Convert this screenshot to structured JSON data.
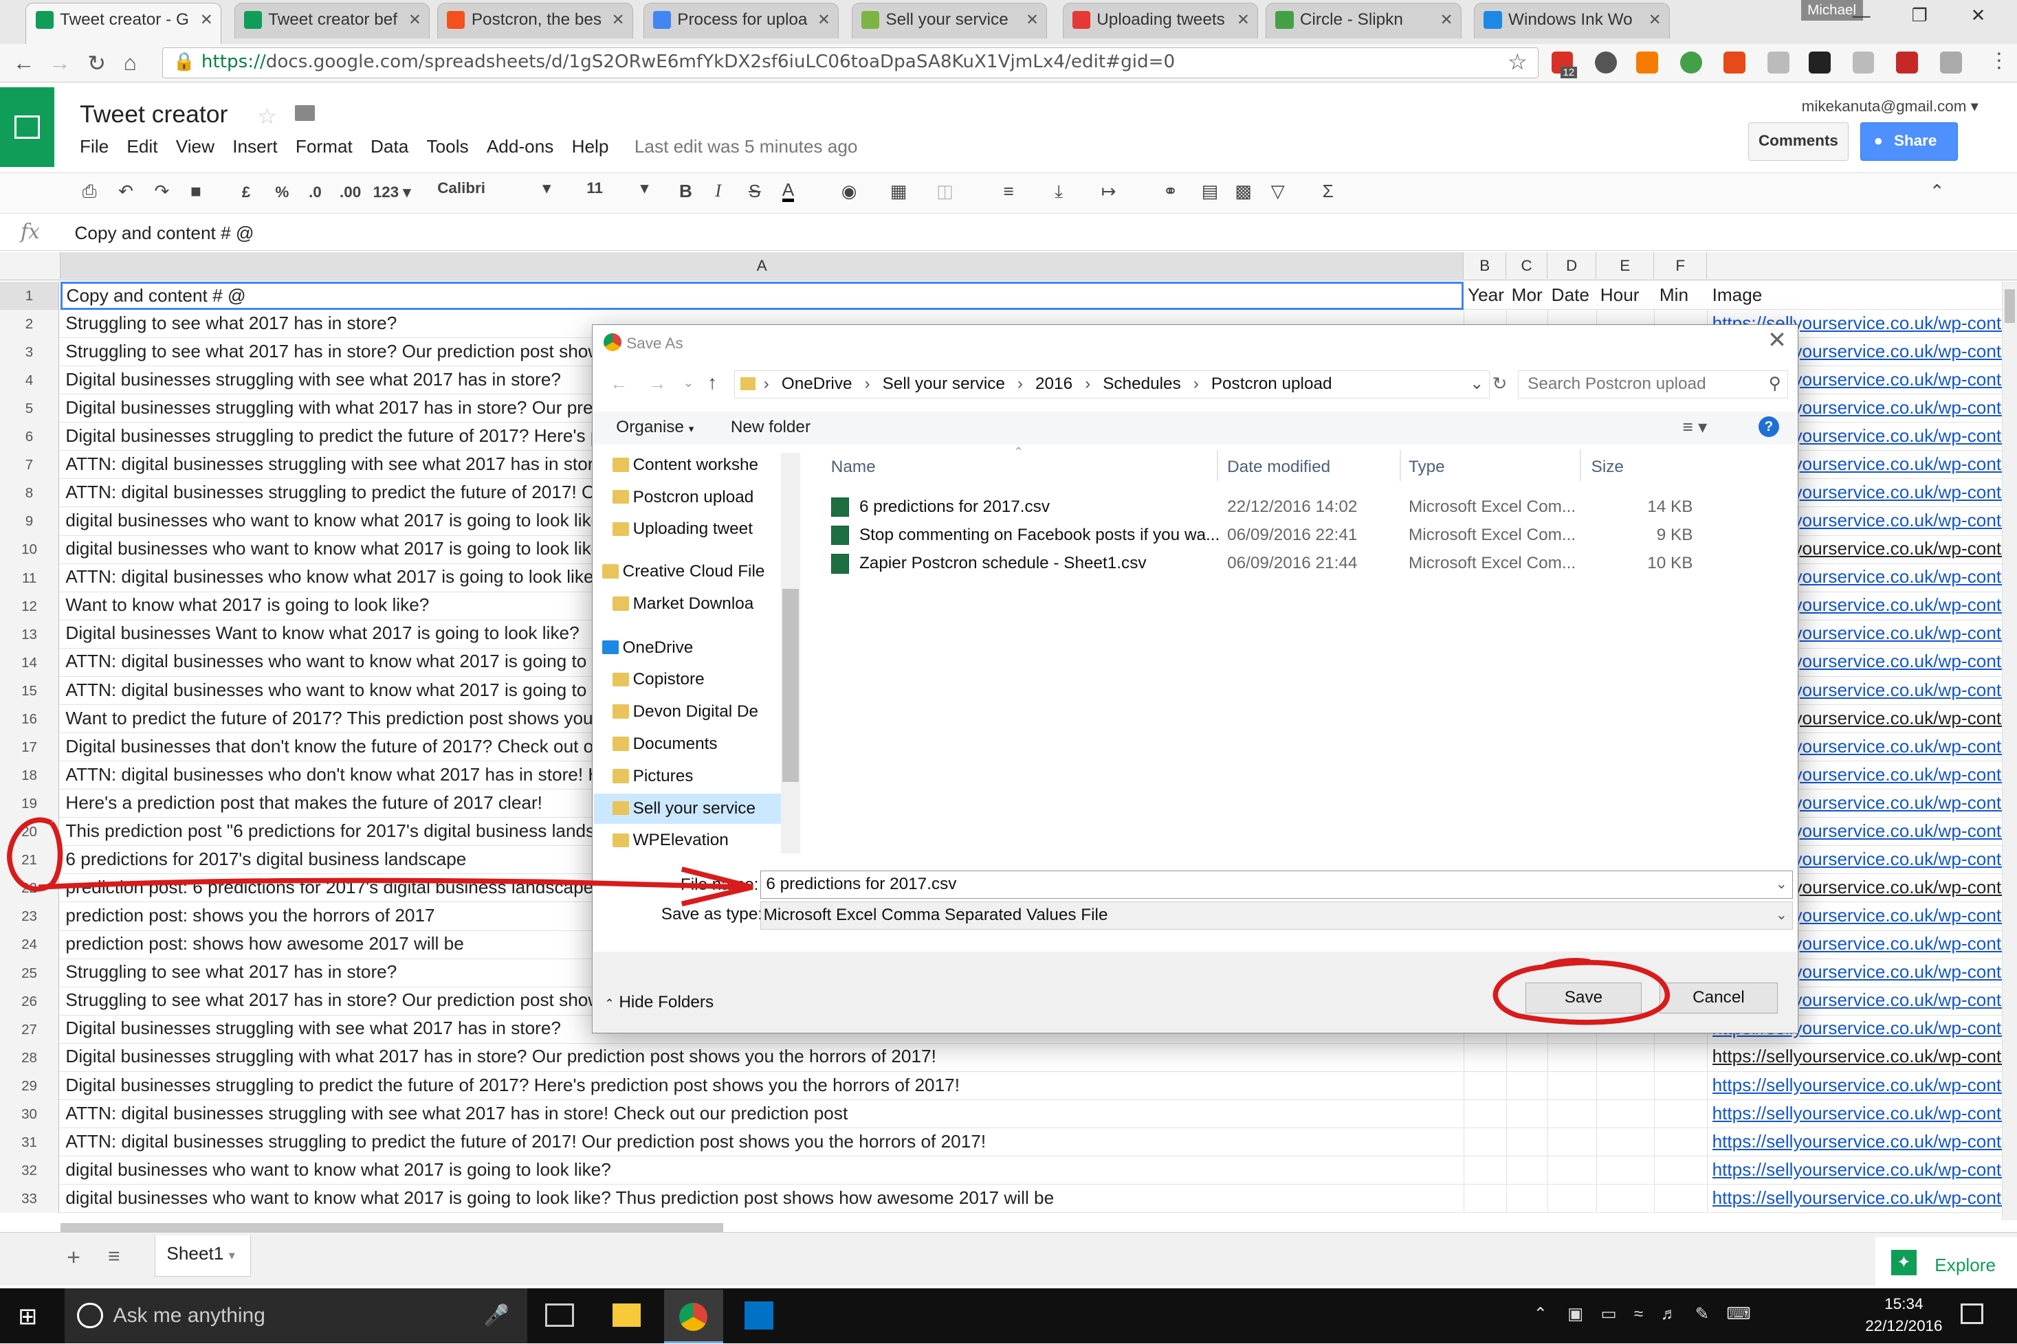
{
  "browser": {
    "tabs": [
      {
        "label": "Tweet creator - G",
        "color": "#0f9d58"
      },
      {
        "label": "Tweet creator bef",
        "color": "#0f9d58"
      },
      {
        "label": "Postcron, the bes",
        "color": "#f4511e"
      },
      {
        "label": "Process for uploa",
        "color": "#4285f4"
      },
      {
        "label": "Sell your service",
        "color": "#7cb342"
      },
      {
        "label": "Uploading tweets",
        "color": "#e53935"
      },
      {
        "label": "Circle - Slipkn",
        "color": "#43a047"
      },
      {
        "label": "Windows Ink Wo",
        "color": "#1e88e5"
      }
    ],
    "profile": "Michael",
    "url_scheme": "https://",
    "url_rest": "docs.google.com/spreadsheets/d/1gS2ORwE6mfYkDX2sf6iuLC06toaDpaSA8KuX1VjmLx4/edit#gid=0",
    "ext_badge": "12"
  },
  "sheets": {
    "title": "Tweet creator",
    "menu": [
      "File",
      "Edit",
      "View",
      "Insert",
      "Format",
      "Data",
      "Tools",
      "Add-ons",
      "Help"
    ],
    "last_edit": "Last edit was 5 minutes ago",
    "account": "mikekanuta@gmail.com",
    "comments": "Comments",
    "share": "Share",
    "toolbar": {
      "currency": "£",
      "percent": "%",
      "dec1": ".0",
      "dec2": ".00",
      "fmt": "123",
      "font": "Calibri",
      "size": "11",
      "bold": "B",
      "italic": "I",
      "strike": "S",
      "color": "A"
    },
    "formula": "Copy and content # @",
    "col_heads": [
      "A",
      "B",
      "C",
      "D",
      "E",
      "F"
    ],
    "header_row": {
      "a": "Copy and content # @",
      "b": "Year",
      "c": "Mor",
      "d": "Date",
      "e": "Hour",
      "f": "Min",
      "g": "Image"
    },
    "rows": [
      {
        "n": "2",
        "a": "Struggling to see what 2017 has in store?",
        "g": "https://sellyourservice.co.uk/wp-conte"
      },
      {
        "n": "3",
        "a": "Struggling to see what 2017 has in store? Our prediction post shows",
        "g": "https://sellyourservice.co.uk/wp-conte"
      },
      {
        "n": "4",
        "a": "Digital businesses struggling with see what 2017 has in store?",
        "g": "https://sellyourservice.co.uk/wp-conte"
      },
      {
        "n": "5",
        "a": "Digital businesses struggling with what 2017 has in store? Our predi",
        "g": "https://sellyourservice.co.uk/wp-conte"
      },
      {
        "n": "6",
        "a": "Digital businesses struggling to predict the future of 2017? Here's pr",
        "g": "https://sellyourservice.co.uk/wp-conte"
      },
      {
        "n": "7",
        "a": "ATTN: digital businesses struggling with see what 2017 has in store!",
        "g": "https://sellyourservice.co.uk/wp-conte"
      },
      {
        "n": "8",
        "a": "ATTN: digital businesses struggling to predict the future of 2017! Our",
        "g": "https://sellyourservice.co.uk/wp-conte"
      },
      {
        "n": "9",
        "a": "digital businesses who want to know what 2017 is going to look like?",
        "g": "https://sellyourservice.co.uk/wp-conte"
      },
      {
        "n": "10",
        "a": "digital businesses who want to know what 2017 is going to look like?",
        "g": "https://sellyourservice.co.uk/wp-conte",
        "dark": true
      },
      {
        "n": "11",
        "a": "ATTN: digital businesses who know what 2017 is going to look like!",
        "g": "https://sellyourservice.co.uk/wp-conte"
      },
      {
        "n": "12",
        "a": "Want to know what 2017 is going to look like?",
        "g": "https://sellyourservice.co.uk/wp-conte"
      },
      {
        "n": "13",
        "a": "Digital businesses Want to know what 2017 is going to look like?",
        "g": "https://sellyourservice.co.uk/wp-conte"
      },
      {
        "n": "14",
        "a": "ATTN: digital businesses who want to know what 2017 is going to lo",
        "g": "https://sellyourservice.co.uk/wp-conte"
      },
      {
        "n": "15",
        "a": "ATTN: digital businesses who want to know what 2017 is going to lo",
        "g": "https://sellyourservice.co.uk/wp-conte"
      },
      {
        "n": "16",
        "a": "Want to predict the future of 2017? This prediction post shows you!",
        "g": "https://sellyourservice.co.uk/wp-conte",
        "dark": true
      },
      {
        "n": "17",
        "a": "Digital businesses that don't know the future of 2017? Check out our",
        "g": "https://sellyourservice.co.uk/wp-conte"
      },
      {
        "n": "18",
        "a": "ATTN: digital businesses who don't know what 2017 has in store! He",
        "g": "https://sellyourservice.co.uk/wp-conte"
      },
      {
        "n": "19",
        "a": "Here's a prediction post that makes the future of 2017 clear!",
        "g": "https://sellyourservice.co.uk/wp-conte"
      },
      {
        "n": "20",
        "a": "This prediction post \"6 predictions for 2017's digital business landsca",
        "g": "https://sellyourservice.co.uk/wp-conte"
      },
      {
        "n": "21",
        "a": "6 predictions for 2017's digital business landscape",
        "g": "https://sellyourservice.co.uk/wp-conte"
      },
      {
        "n": "22",
        "a": "prediction post: 6 predictions for 2017's digital business landscape",
        "g": "https://sellyourservice.co.uk/wp-conte",
        "dark": true
      },
      {
        "n": "23",
        "a": "prediction post: shows you the horrors of 2017",
        "g": "https://sellyourservice.co.uk/wp-conte"
      },
      {
        "n": "24",
        "a": "prediction post: shows how awesome 2017 will be",
        "g": "https://sellyourservice.co.uk/wp-conte"
      },
      {
        "n": "25",
        "a": "Struggling to see what 2017 has in store?",
        "g": "https://sellyourservice.co.uk/wp-conte"
      },
      {
        "n": "26",
        "a": "Struggling to see what 2017 has in store? Our prediction post shows",
        "g": "https://sellyourservice.co.uk/wp-conte"
      },
      {
        "n": "27",
        "a": "Digital businesses struggling with see what 2017 has in store?",
        "g": "https://sellyourservice.co.uk/wp-conte"
      },
      {
        "n": "28",
        "a": "Digital businesses struggling with what 2017 has in store? Our prediction post shows you the horrors of 2017!",
        "g": "https://sellyourservice.co.uk/wp-conte",
        "dark": true
      },
      {
        "n": "29",
        "a": "Digital businesses struggling to predict the future of 2017? Here's prediction post shows you the horrors of 2017!",
        "g": "https://sellyourservice.co.uk/wp-conte"
      },
      {
        "n": "30",
        "a": "ATTN: digital businesses struggling with see what 2017 has in store! Check out our prediction post",
        "g": "https://sellyourservice.co.uk/wp-conte"
      },
      {
        "n": "31",
        "a": "ATTN: digital businesses struggling to predict the future of 2017! Our prediction post shows you the horrors of 2017!",
        "g": "https://sellyourservice.co.uk/wp-conte"
      },
      {
        "n": "32",
        "a": "digital businesses who want to know what 2017 is going to look like?",
        "g": "https://sellyourservice.co.uk/wp-conte"
      },
      {
        "n": "33",
        "a": "digital businesses who want to know what 2017 is going to look like? Thus prediction post shows how awesome 2017 will be",
        "g": "https://sellyourservice.co.uk/wp-conte"
      }
    ],
    "sheet_tab": "Sheet1",
    "explore": "Explore"
  },
  "dialog": {
    "title": "Save As",
    "breadcrumb": [
      "OneDrive",
      "Sell your service",
      "2016",
      "Schedules",
      "Postcron upload"
    ],
    "search_placeholder": "Search Postcron upload",
    "organise": "Organise",
    "new_folder": "New folder",
    "nav_items": [
      {
        "label": "Content workshe",
        "icon": "folder-sync-icon"
      },
      {
        "label": "Postcron upload",
        "icon": "folder-sync-icon"
      },
      {
        "label": "Uploading tweet",
        "icon": "folder-sync-icon"
      },
      {
        "label": "Creative Cloud File",
        "icon": "folder-icon"
      },
      {
        "label": "Market Downloa",
        "icon": "folder-icon"
      },
      {
        "label": "OneDrive",
        "icon": "cloud-icon"
      },
      {
        "label": "Copistore",
        "icon": "folder-sync-icon"
      },
      {
        "label": "Devon Digital De",
        "icon": "folder-sync-icon"
      },
      {
        "label": "Documents",
        "icon": "folder-error-icon"
      },
      {
        "label": "Pictures",
        "icon": "folder-error-icon"
      },
      {
        "label": "Sell your service",
        "icon": "folder-sync-icon"
      },
      {
        "label": "WPElevation",
        "icon": "folder-sync-icon"
      }
    ],
    "columns": {
      "name": "Name",
      "date": "Date modified",
      "type": "Type",
      "size": "Size"
    },
    "files": [
      {
        "name": "6 predictions for 2017.csv",
        "date": "22/12/2016 14:02",
        "type": "Microsoft Excel Com...",
        "size": "14 KB"
      },
      {
        "name": "Stop commenting on Facebook posts if you wa...",
        "date": "06/09/2016 22:41",
        "type": "Microsoft Excel Com...",
        "size": "9 KB"
      },
      {
        "name": "Zapier Postcron schedule - Sheet1.csv",
        "date": "06/09/2016 21:44",
        "type": "Microsoft Excel Com...",
        "size": "10 KB"
      }
    ],
    "file_name_label": "File name:",
    "file_name": "6 predictions for 2017.csv",
    "save_type_label": "Save as type:",
    "save_type": "Microsoft Excel Comma Separated Values File",
    "hide_folders": "Hide Folders",
    "save": "Save",
    "cancel": "Cancel"
  },
  "taskbar": {
    "search": "Ask me anything",
    "time": "15:34",
    "date": "22/12/2016"
  },
  "colors": {
    "sheets_green": "#0f9d58",
    "link_blue": "#1155cc",
    "share_blue": "#4d90fe",
    "annotation_red": "#d81b1b",
    "selection": "#cce8ff"
  }
}
